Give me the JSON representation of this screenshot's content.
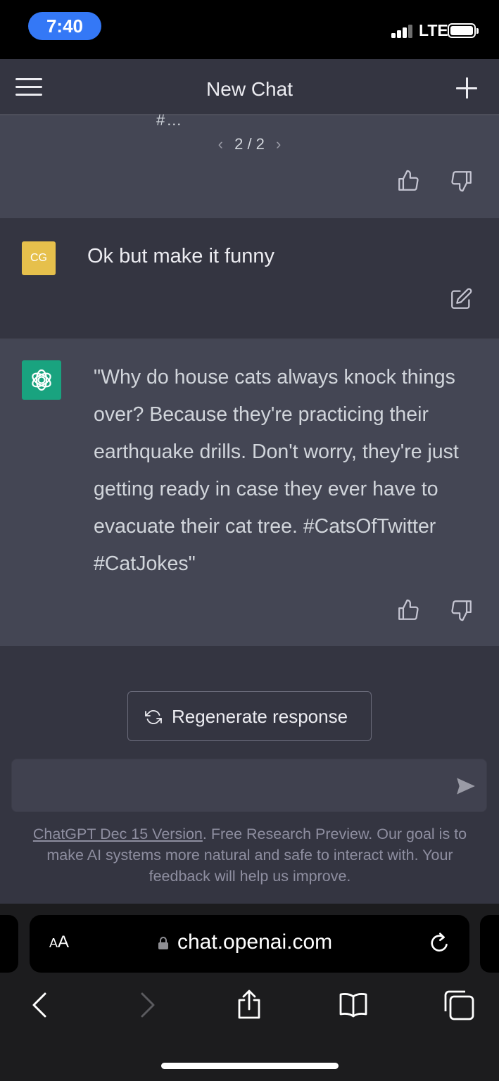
{
  "status_bar": {
    "time": "7:40",
    "network": "LTE",
    "signal_bars_active": 3,
    "signal_bars_total": 4,
    "battery_level": 0.95
  },
  "header": {
    "title": "New Chat",
    "menu_icon": "hamburger-menu-icon",
    "new_chat_icon": "plus-icon"
  },
  "conversation": {
    "previous_response": {
      "cut_off_text": "#…",
      "pager": {
        "current": "2",
        "separator": "/",
        "total": "2",
        "text": "2 / 2"
      }
    },
    "user_message": {
      "avatar_initials": "CG",
      "text": "Ok but make it funny"
    },
    "assistant_message": {
      "text": "\"Why do house cats always knock things over? Because they're practicing their earthquake drills. Don't worry, they're just getting ready in case they ever have to evacuate their cat tree. #CatsOfTwitter #CatJokes\""
    }
  },
  "composer": {
    "regenerate_label": "Regenerate response",
    "input_value": "",
    "send_icon": "paper-plane-icon"
  },
  "footer": {
    "version_link": "ChatGPT Dec 15 Version",
    "note": ". Free Research Preview. Our goal is to make AI systems more natural and safe to interact with. Your feedback will help us improve."
  },
  "browser": {
    "text_size_label_big": "A",
    "text_size_label_small": "A",
    "url": "chat.openai.com"
  },
  "colors": {
    "assistant_bg": "#444654",
    "user_bg": "#343541",
    "avatar_user": "#e6c04c",
    "avatar_gpt": "#19a37f",
    "time_pill": "#3478f6"
  }
}
